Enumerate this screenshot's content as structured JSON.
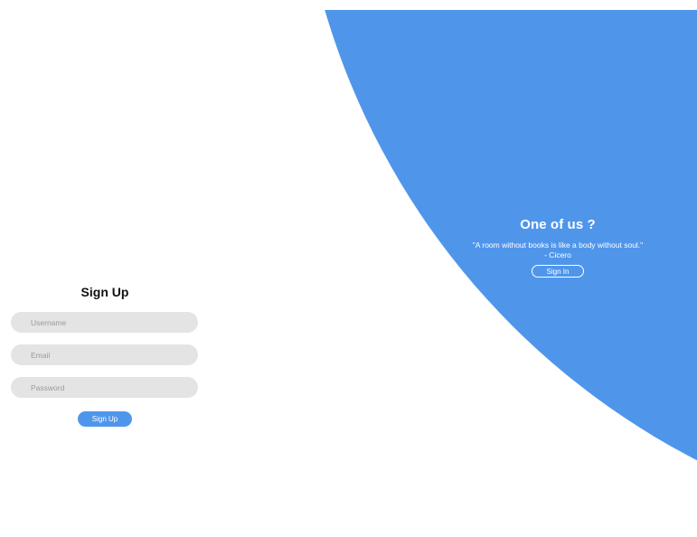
{
  "signup": {
    "title": "Sign Up",
    "username_placeholder": "Username",
    "email_placeholder": "Email",
    "password_placeholder": "Password",
    "submit_label": "Sign Up"
  },
  "panel": {
    "title": "One of us ?",
    "quote": "\"A room without books is like a body without soul.\"",
    "author": "- Cicero",
    "sign_in_label": "Sign In"
  },
  "colors": {
    "accent": "#4f96eb",
    "input_background": "#e4e4e4",
    "page_background": "#ffffff"
  }
}
